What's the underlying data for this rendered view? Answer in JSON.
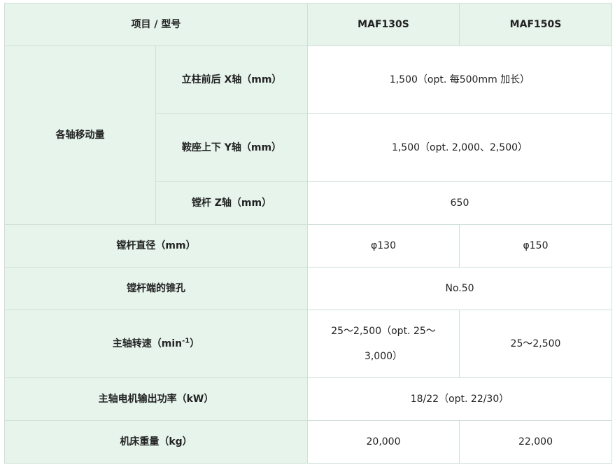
{
  "header": {
    "item_label": "项目 / 型号",
    "model_1": "MAF130S",
    "model_2": "MAF150S"
  },
  "rows": {
    "axis_travel": {
      "label": "各轴移动量",
      "x_axis": {
        "label": "立柱前后  X轴（mm）",
        "value": "1,500（opt. 每500mm 加长）"
      },
      "y_axis": {
        "label": "鞍座上下  Y轴（mm）",
        "value": "1,500（opt. 2,000、2,500）"
      },
      "z_axis": {
        "label": "镗杆  Z轴（mm）",
        "value": "650"
      }
    },
    "bar_diameter": {
      "label": "镗杆直径（mm）",
      "value_1": "φ130",
      "value_2": "φ150"
    },
    "taper": {
      "label": "镗杆端的锥孔",
      "value": "No.50"
    },
    "spindle_speed": {
      "label_prefix": "主轴转速（min",
      "label_sup": "-1",
      "label_suffix": "）",
      "value_1": "25～2,500（opt. 25～3,000）",
      "value_2": "25～2,500"
    },
    "motor_power": {
      "label": "主轴电机输出功率（kW）",
      "value": "18/22（opt. 22/30）"
    },
    "weight": {
      "label": "机床重量（kg）",
      "value_1": "20,000",
      "value_2": "22,000"
    }
  },
  "colors": {
    "header_bg": "#e6f4ec",
    "border": "#cfe0d6",
    "text": "#222222"
  }
}
